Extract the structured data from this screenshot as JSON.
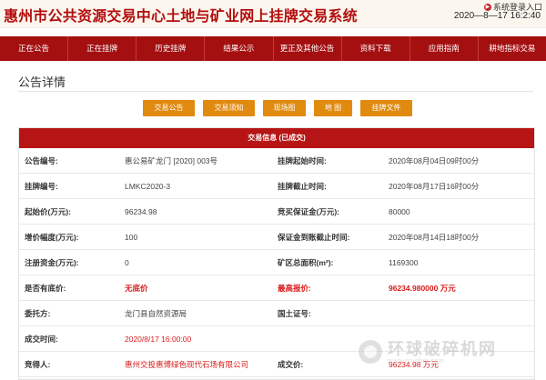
{
  "header": {
    "site_title": "惠州市公共资源交易中心土地与矿业网上挂牌交易系统",
    "login_label": "系统登录入口",
    "datetime": "2020—8—17 16:2:40"
  },
  "nav": {
    "items": [
      {
        "label": "正在公告"
      },
      {
        "label": "正在挂牌"
      },
      {
        "label": "历史挂牌"
      },
      {
        "label": "结果公示"
      },
      {
        "label": "更正及其他公告"
      },
      {
        "label": "资料下载"
      },
      {
        "label": "应用指南"
      },
      {
        "label": "耕地指标交易"
      }
    ]
  },
  "page": {
    "title": "公告详情"
  },
  "tabs": [
    {
      "label": "交易公告"
    },
    {
      "label": "交易须知"
    },
    {
      "label": "现场图"
    },
    {
      "label": "地 图"
    },
    {
      "label": "挂牌文件"
    }
  ],
  "info": {
    "header": "交易信息 (已成交)",
    "rows": [
      {
        "l1": "公告编号:",
        "v1": "惠公易矿龙门 [2020] 003号",
        "l2": "挂牌起始时间:",
        "v2": "2020年08月04日09时00分"
      },
      {
        "l1": "挂牌编号:",
        "v1": "LMKC2020-3",
        "l2": "挂牌截止时间:",
        "v2": "2020年08月17日16时00分"
      },
      {
        "l1": "起始价(万元):",
        "v1": "96234.98",
        "l2": "竞买保证金(万元):",
        "v2": "80000"
      },
      {
        "l1": "增价幅度(万元):",
        "v1": "100",
        "l2": "保证金到账截止时间:",
        "v2": "2020年08月14日18时00分"
      },
      {
        "l1": "注册资金(万元):",
        "v1": "0",
        "l2": "矿区总面积(m²):",
        "v2": "1169300"
      },
      {
        "l1": "是否有底价:",
        "v1": "无底价",
        "l2": "最高报价:",
        "v2": "96234.980000 万元"
      },
      {
        "l1": "委托方:",
        "v1": "龙门县自然资源局",
        "l2": "国土证号:",
        "v2": ""
      },
      {
        "l1": "成交时间:",
        "v1": "2020/8/17 16:00:00",
        "l2": "",
        "v2": ""
      },
      {
        "l1": "竞得人:",
        "v1": "惠州交投惠博绿色现代石场有限公司",
        "l2": "成交价:",
        "v2": "96234.98 万元"
      }
    ]
  },
  "watermark": {
    "cn": "环球破碎机网",
    "en": "www.crusher.com"
  }
}
